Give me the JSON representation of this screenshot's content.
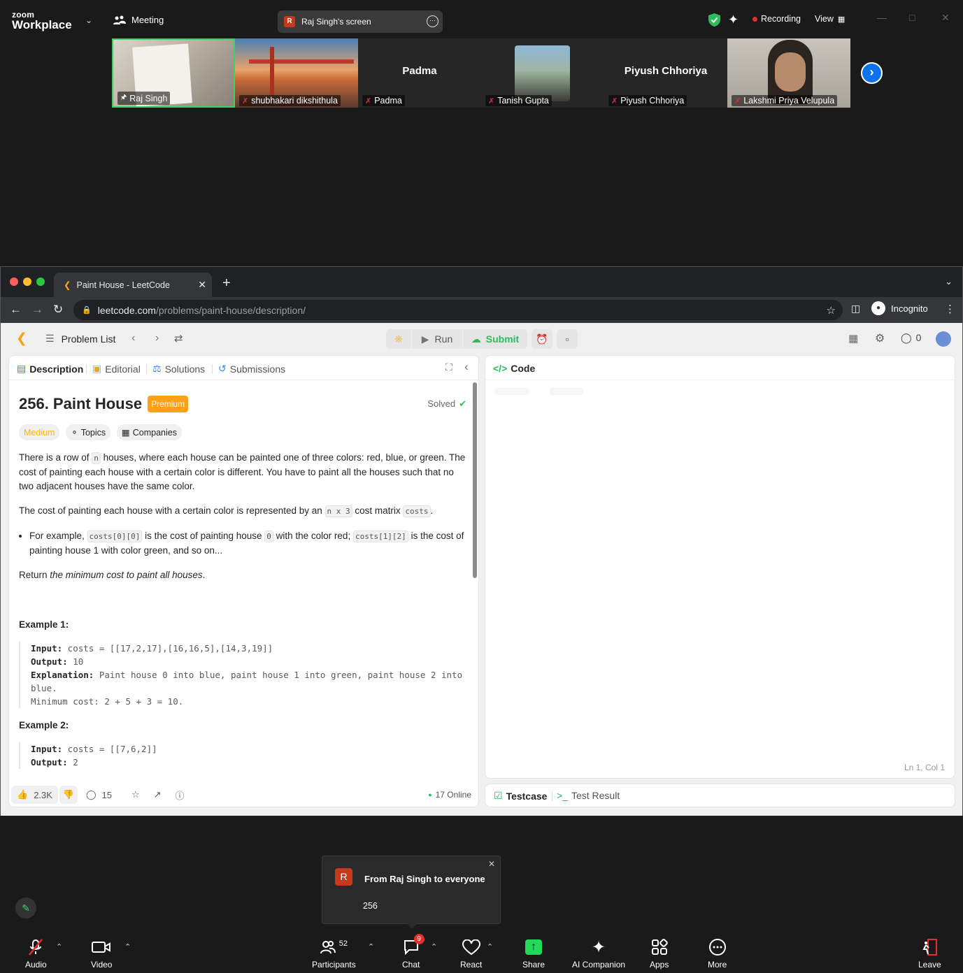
{
  "zoom": {
    "brand_small": "zoom",
    "brand_big": "Workplace",
    "meeting_label": "Meeting",
    "screen_share_label": "Raj Singh's screen",
    "screen_share_initial": "R",
    "recording_label": "Recording",
    "view_label": "View",
    "participants_strip": [
      {
        "name": "Raj Singh",
        "muted": false,
        "pinned": true,
        "type": "video"
      },
      {
        "name": "shubhakari dikshithula",
        "muted": true,
        "type": "video"
      },
      {
        "name": "Padma",
        "muted": true,
        "type": "name",
        "center": "Padma"
      },
      {
        "name": "Tanish Gupta",
        "muted": true,
        "type": "photo"
      },
      {
        "name": "Piyush Chhoriya",
        "muted": true,
        "type": "name",
        "center": "Piyush Chhoriya"
      },
      {
        "name": "Lakshmi Priya Velupula",
        "muted": true,
        "type": "video"
      }
    ],
    "chat_popup": {
      "initial": "R",
      "title": "From Raj Singh to everyone",
      "message": "256"
    },
    "toolbar": {
      "audio": "Audio",
      "video": "Video",
      "participants": "Participants",
      "participants_count": "52",
      "chat": "Chat",
      "chat_badge": "9",
      "react": "React",
      "share": "Share",
      "ai_companion": "AI Companion",
      "apps": "Apps",
      "more": "More",
      "leave": "Leave"
    },
    "colors": {
      "accent_blue": "#0e72ed",
      "share_green": "#23d959",
      "record_red": "#e0312e",
      "pin_green": "#3fd166"
    }
  },
  "browser": {
    "tab_title": "Paint House - LeetCode",
    "url_host": "leetcode.com",
    "url_path": "/problems/paint-house/description/",
    "incognito_label": "Incognito"
  },
  "leetcode": {
    "problem_list": "Problem List",
    "run": "Run",
    "submit": "Submit",
    "streak": "0",
    "tabs": {
      "description": "Description",
      "editorial": "Editorial",
      "solutions": "Solutions",
      "submissions": "Submissions"
    },
    "code_tab": "Code",
    "title": "256. Paint House",
    "premium": "Premium",
    "solved": "Solved",
    "difficulty": "Medium",
    "topics": "Topics",
    "companies": "Companies",
    "p1_a": "There is a row of ",
    "p1_n": "n",
    "p1_b": " houses, where each house can be painted one of three colors: red, blue, or green. The cost of painting each house with a certain color is different. You have to paint all the houses such that no two adjacent houses have the same color.",
    "p2_a": "The cost of painting each house with a certain color is represented by an ",
    "p2_code1": "n x 3",
    "p2_b": " cost matrix ",
    "p2_code2": "costs",
    "p2_c": ".",
    "b1_a": "For example, ",
    "b1_code1": "costs[0][0]",
    "b1_b": " is the cost of painting house ",
    "b1_code2": "0",
    "b1_c": " with the color red; ",
    "b1_code3": "costs[1][2]",
    "b1_d": " is the cost of painting house 1 with color green, and so on...",
    "p3_a": "Return ",
    "p3_em": "the minimum cost to paint all houses",
    "p3_b": ".",
    "ex1_title": "Example 1:",
    "ex1_input_label": "Input:",
    "ex1_input": " costs = [[17,2,17],[16,16,5],[14,3,19]]",
    "ex1_output_label": "Output:",
    "ex1_output": " 10",
    "ex1_expl_label": "Explanation:",
    "ex1_expl": " Paint house 0 into blue, paint house 1 into green, paint house 2 into blue.",
    "ex1_min": "Minimum cost: 2 + 5 + 3 = 10.",
    "ex2_title": "Example 2:",
    "ex2_input_label": "Input:",
    "ex2_input": " costs = [[7,6,2]]",
    "ex2_output_label": "Output:",
    "ex2_output": " 2",
    "likes": "2.3K",
    "comments": "15",
    "online": "17 Online",
    "cursor_pos": "Ln 1, Col 1",
    "testcase": "Testcase",
    "test_result": "Test Result",
    "colors": {
      "submit_green": "#2cbb5d",
      "premium_orange": "#ffa116",
      "medium_yellow": "#ffb800"
    }
  }
}
